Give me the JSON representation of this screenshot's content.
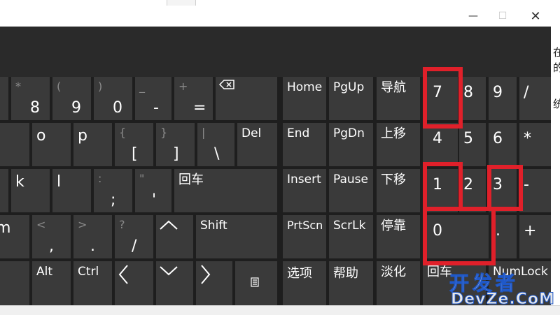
{
  "window": {
    "minimize_icon": "minimize-icon",
    "maximize_icon": "maximize-icon",
    "close_icon": "close-icon"
  },
  "keys": {
    "k8": {
      "main": "8",
      "shift": "*"
    },
    "k9": {
      "main": "9",
      "shift": "("
    },
    "k0": {
      "main": "0",
      "shift": ")"
    },
    "minus": {
      "main": "-",
      "shift": "_"
    },
    "equals": {
      "main": "=",
      "shift": "+"
    },
    "o": {
      "main": "o"
    },
    "p": {
      "main": "p"
    },
    "lbracket": {
      "main": "[",
      "shift": "{"
    },
    "rbracket": {
      "main": "]",
      "shift": "}"
    },
    "backslash": {
      "main": "\\",
      "shift": "|"
    },
    "del": {
      "label": "Del"
    },
    "k": {
      "main": "k"
    },
    "l": {
      "main": "l"
    },
    "semicolon": {
      "main": ";",
      "shift": ":"
    },
    "quote": {
      "main": "'",
      "shift": "\""
    },
    "enter": {
      "label": "回车"
    },
    "m": {
      "main": "m"
    },
    "comma": {
      "main": ",",
      "shift": "<"
    },
    "period": {
      "main": ".",
      "shift": ">"
    },
    "slash": {
      "main": "/",
      "shift": "?"
    },
    "shift": {
      "label": "Shift"
    },
    "alt": {
      "label": "Alt"
    },
    "ctrl": {
      "label": "Ctrl"
    },
    "home": {
      "label": "Home"
    },
    "pgup": {
      "label": "PgUp"
    },
    "nav": {
      "label": "导航"
    },
    "end": {
      "label": "End"
    },
    "pgdn": {
      "label": "PgDn"
    },
    "moveup": {
      "label": "上移"
    },
    "insert": {
      "label": "Insert"
    },
    "pause": {
      "label": "Pause"
    },
    "movedown": {
      "label": "下移"
    },
    "prtscn": {
      "label": "PrtScn"
    },
    "scrlk": {
      "label": "ScrLk"
    },
    "dock": {
      "label": "停靠"
    },
    "options": {
      "label": "选项"
    },
    "help": {
      "label": "帮助"
    },
    "fade": {
      "label": "淡化"
    },
    "num7": {
      "main": "7"
    },
    "num8": {
      "main": "8"
    },
    "num9": {
      "main": "9"
    },
    "numslash": {
      "main": "/"
    },
    "num4": {
      "main": "4"
    },
    "num5": {
      "main": "5"
    },
    "num6": {
      "main": "6"
    },
    "numstar": {
      "main": "*"
    },
    "num1": {
      "main": "1"
    },
    "num2": {
      "main": "2"
    },
    "num3": {
      "main": "3"
    },
    "numminus": {
      "main": "-"
    },
    "num0": {
      "main": "0"
    },
    "numdot": {
      "main": "."
    },
    "numplus": {
      "main": "+"
    },
    "numenter": {
      "label": "回车"
    },
    "numlock": {
      "label": "NumLock"
    }
  },
  "watermark": {
    "cn": "开发者",
    "en": "DevZe.CoM"
  }
}
